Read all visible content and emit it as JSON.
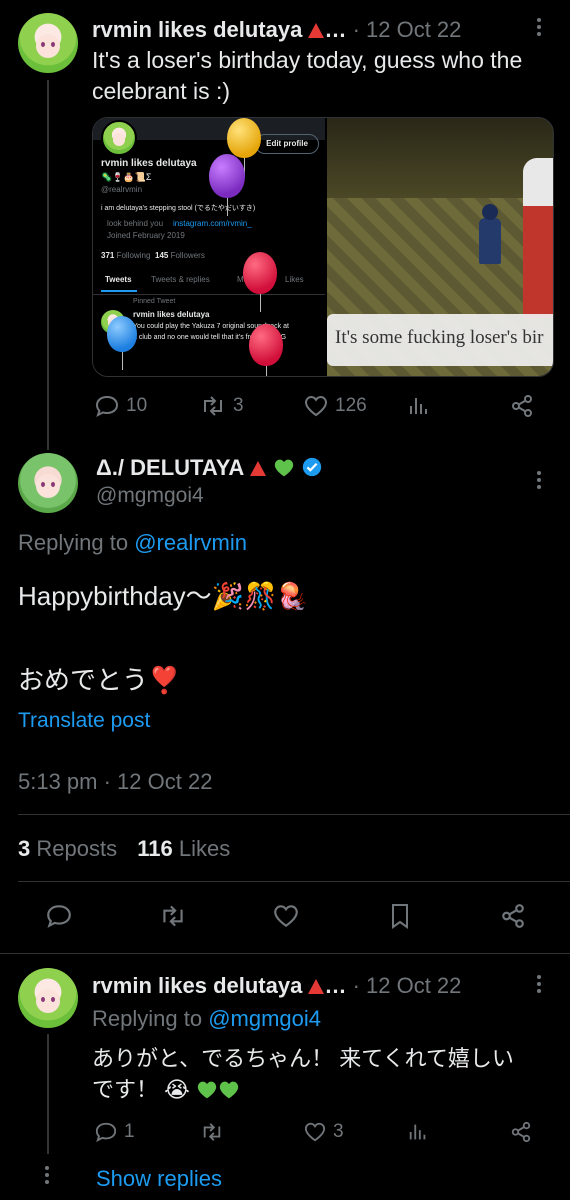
{
  "tweet1": {
    "name": "rvmin likes delutaya",
    "name_suffix": "…",
    "date": "· 12 Oct 22",
    "text": "It's a loser's birthday today, guess who the celebrant is :)",
    "replies": "10",
    "reposts": "3",
    "likes": "126",
    "media": {
      "profile_name": "rvmin likes delutaya",
      "handle": "@realrvmin",
      "edit_profile": "Edit profile",
      "bio": "i am delutaya's stepping stool (でるたやだいすき)",
      "location": "look behind you",
      "website": "instagram.com/rvmin_",
      "joined": "Joined February 2019",
      "following_count": "371",
      "following_label": "Following",
      "followers_count": "145",
      "followers_label": "Followers",
      "tabs": [
        "Tweets",
        "Tweets & replies",
        "Media",
        "Likes"
      ],
      "pinned": "Pinned Tweet",
      "pinned_name": "rvmin likes delutaya",
      "pinned_text_1": "You could play the Yakuza 7 original soundtrack at",
      "pinned_text_2": "a club and no one would tell that it's from a JRPG",
      "subtitle": "It's some fucking loser's bir"
    }
  },
  "tweet2": {
    "name": "Δ./ DELUTAYA",
    "handle": "@mgmgoi4",
    "replying_prefix": "Replying to",
    "replying_to": "@realrvmin",
    "text_line1": "Happybirthday～🎉🎊🪼",
    "text_line2": "おめでとう❣️",
    "translate": "Translate post",
    "timestamp": "5:13 pm · 12 Oct 22",
    "reposts_count": "3",
    "reposts_label": "Reposts",
    "likes_count": "116",
    "likes_label": "Likes"
  },
  "tweet3": {
    "name": "rvmin likes delutaya",
    "name_suffix": "…",
    "date": "· 12 Oct 22",
    "replying_prefix": "Replying to",
    "replying_to": "@mgmgoi4",
    "text_line1": "ありがと、でるちゃん！ 来てくれて嬉しい",
    "text_line2": "です！",
    "text_emoji": "😭",
    "replies": "1",
    "likes": "3"
  },
  "show_replies": "Show replies",
  "colors": {
    "background": "#000000",
    "text": "#e7e9ea",
    "muted": "#71767b",
    "accent": "#1d9bf0",
    "divider": "#2f3336"
  }
}
